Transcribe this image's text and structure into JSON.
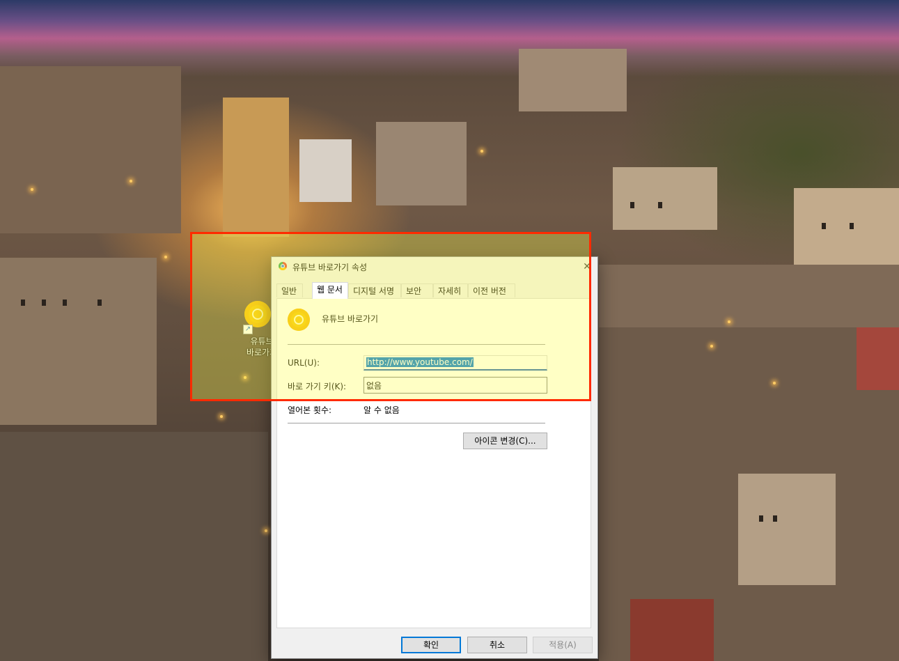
{
  "dialog": {
    "title": "유튜브 바로가기 속성",
    "close_glyph": "✕",
    "tabs": [
      {
        "label": "일반"
      },
      {
        "label": "웹 문서"
      },
      {
        "label": "디지털 서명"
      },
      {
        "label": "보안"
      },
      {
        "label": "자세히"
      },
      {
        "label": "이전 버전"
      }
    ],
    "active_tab": "웹 문서",
    "shortcut_name": "유튜브 바로가기",
    "url_label": "URL(U):",
    "url_value": "http://www.youtube.com/",
    "hotkey_label": "바로 가기 키(K):",
    "hotkey_value": "없음",
    "visits_label": "열어본 횟수:",
    "visits_value": "알 수 없음",
    "change_icon_button": "아이콘 변경(C)...",
    "buttons": {
      "ok": "확인",
      "cancel": "취소",
      "apply": "적용(A)"
    }
  },
  "desktop_icon": {
    "label_line1": "유튜브",
    "label_line2": "바로가기",
    "icon": "chrome-shortcut-icon"
  },
  "colors": {
    "highlight_border": "#ff2a00",
    "highlight_fill": "#ffff50",
    "accent": "#0078d7"
  }
}
